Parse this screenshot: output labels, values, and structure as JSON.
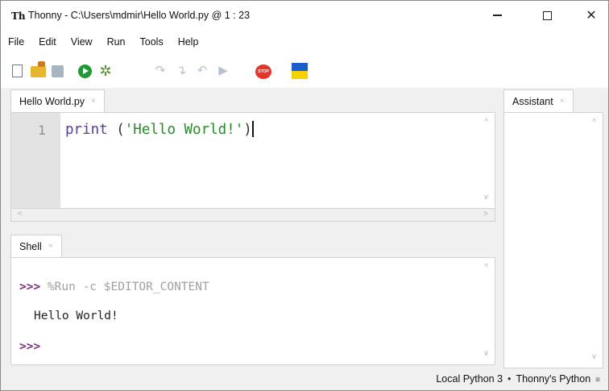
{
  "window": {
    "title": "Thonny  -  C:\\Users\\mdmir\\Hello World.py  @  1 : 23",
    "app_icon": "Th",
    "minimize": "—",
    "maximize": "☐",
    "close": "✕"
  },
  "menu": [
    "File",
    "Edit",
    "View",
    "Run",
    "Tools",
    "Help"
  ],
  "toolbar": {
    "icons": [
      "new-file-icon",
      "open-folder-icon",
      "save-icon",
      "run-icon",
      "debug-icon",
      "step-over-icon",
      "step-into-icon",
      "step-out-icon",
      "resume-icon",
      "stop-icon",
      "ukraine-flag-icon"
    ],
    "stop_label": "STOP",
    "step_over_glyph": "↷",
    "step_into_glyph": "↴",
    "step_out_glyph": "↶",
    "resume_glyph": "▶",
    "debug_glyph": "✲"
  },
  "editor": {
    "tab_label": "Hello World.py",
    "tab_close": "×",
    "line_number": "1",
    "code_keyword": "print",
    "code_open": " (",
    "code_string": "'Hello World!'",
    "code_close": ")"
  },
  "shell": {
    "tab_label": "Shell",
    "tab_close": "×",
    "prompt": ">>>",
    "command": " %Run -c $EDITOR_CONTENT",
    "output": "Hello World!",
    "prompt2": ">>>"
  },
  "assistant": {
    "tab_label": "Assistant",
    "tab_close": "×"
  },
  "status": {
    "interpreter": "Local Python 3",
    "separator": "•",
    "env": "Thonny's Python",
    "menu_glyph": "≡"
  },
  "scroll": {
    "up": "^",
    "down": "v",
    "left": "<",
    "right": ">"
  },
  "colors": {
    "keyword": "#5a3d8a",
    "string": "#2a8a2a",
    "prompt": "#7c2d7c",
    "run_button": "#1e9a35",
    "stop_button": "#e2362e"
  }
}
